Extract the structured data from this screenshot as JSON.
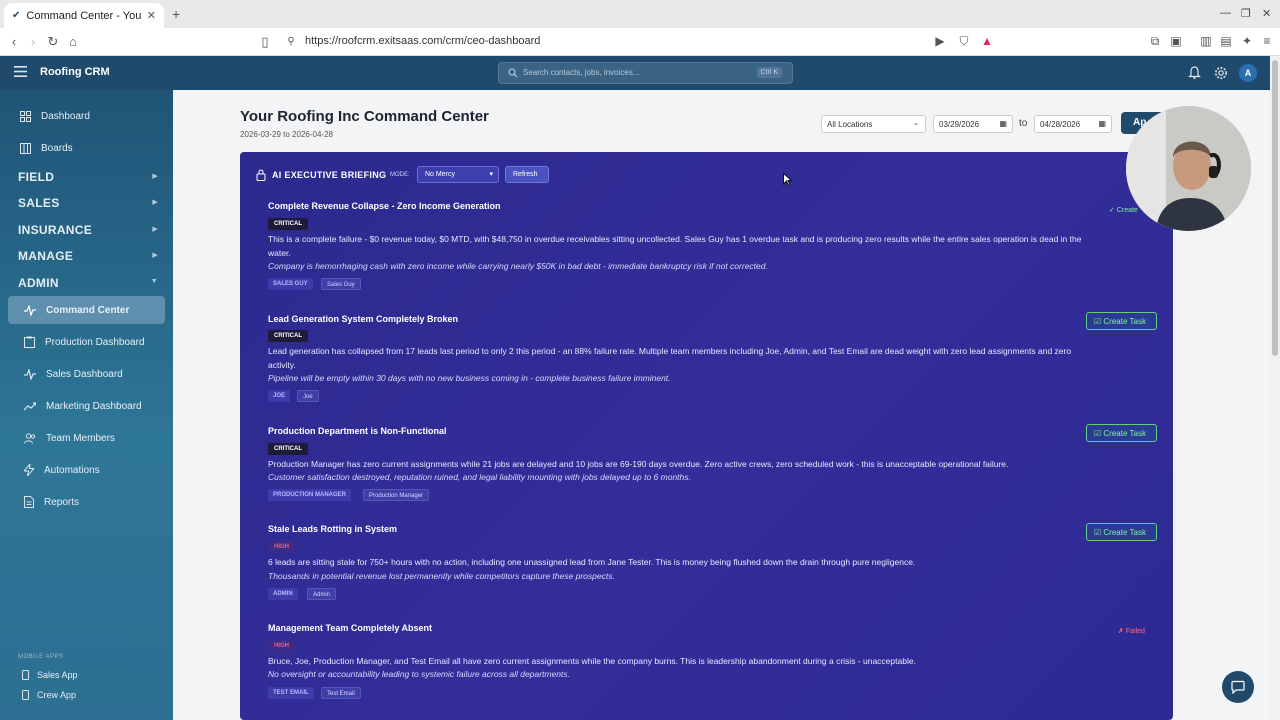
{
  "browser": {
    "tab_title": "Command Center - Your R",
    "url": "https://roofcrm.exitsaas.com/crm/ceo-dashboard"
  },
  "header": {
    "brand": "Roofing CRM",
    "search_placeholder": "Search contacts, jobs, invoices...",
    "search_shortcut": "Ctrl K",
    "avatar_initial": "A"
  },
  "sidebar": {
    "top_items": [
      {
        "label": "Dashboard",
        "icon": "grid-icon"
      },
      {
        "label": "Boards",
        "icon": "board-icon"
      }
    ],
    "sections": [
      "FIELD",
      "SALES",
      "INSURANCE",
      "MANAGE",
      "ADMIN"
    ],
    "admin_items": [
      {
        "label": "Command Center",
        "icon": "pulse-icon",
        "active": true
      },
      {
        "label": "Production Dashboard",
        "icon": "clipboard-icon"
      },
      {
        "label": "Sales Dashboard",
        "icon": "pulse-icon"
      },
      {
        "label": "Marketing Dashboard",
        "icon": "trend-icon"
      },
      {
        "label": "Team Members",
        "icon": "users-icon"
      },
      {
        "label": "Automations",
        "icon": "bolt-icon"
      },
      {
        "label": "Reports",
        "icon": "document-icon"
      }
    ],
    "mobile_heading": "MOBILE APPS",
    "mobile_items": [
      "Sales App",
      "Crew App"
    ]
  },
  "page": {
    "title": "Your Roofing Inc Command Center",
    "range": "2026-03-29 to 2026-04-28",
    "location_filter": "All Locations",
    "date_from": "03/29/2026",
    "to_label": "to",
    "date_to": "04/28/2026",
    "apply_label": "Ap"
  },
  "briefing": {
    "title": "AI EXECUTIVE BRIEFING",
    "mode_label": "MODE:",
    "mode_value": "No Mercy",
    "refresh_label": "Refresh",
    "create_task_label": "Create Task",
    "created_label": "Create",
    "failed_label": "Failed",
    "items": [
      {
        "title": "Complete Revenue Collapse - Zero Income Generation",
        "severity": "CRITICAL",
        "body": "This is a complete failure - $0 revenue today, $0 MTD, with $48,750 in overdue receivables sitting uncollected. Sales Guy has 1 overdue task and is producing zero results while the entire sales operation is dead in the water.",
        "impact": "Company is hemorrhaging cash with zero income while carrying nearly $50K in bad debt - immediate bankruptcy risk if not corrected.",
        "role_tag": "SALES GUY",
        "person_tag": "Sales Guy"
      },
      {
        "title": "Lead Generation System Completely Broken",
        "severity": "CRITICAL",
        "body": "Lead generation has collapsed from 17 leads last period to only 2 this period - an 88% failure rate. Multiple team members including Joe, Admin, and Test Email are dead weight with zero lead assignments and zero activity.",
        "impact": "Pipeline will be empty within 30 days with no new business coming in - complete business failure imminent.",
        "role_tag": "JOE",
        "person_tag": "Joe"
      },
      {
        "title": "Production Department is Non-Functional",
        "severity": "CRITICAL",
        "body": "Production Manager has zero current assignments while 21 jobs are delayed and 10 jobs are 69-190 days overdue. Zero active crews, zero scheduled work - this is unacceptable operational failure.",
        "impact": "Customer satisfaction destroyed, reputation ruined, and legal liability mounting with jobs delayed up to 6 months.",
        "role_tag": "PRODUCTION MANAGER",
        "person_tag": "Production Manager"
      },
      {
        "title": "Stale Leads Rotting in System",
        "severity": "HIGH",
        "body": "6 leads are sitting stale for 750+ hours with no action, including one unassigned lead from Jane Tester. This is money being flushed down the drain through pure negligence.",
        "impact": "Thousands in potential revenue lost permanently while competitors capture these prospects.",
        "role_tag": "ADMIN",
        "person_tag": "Admin"
      },
      {
        "title": "Management Team Completely Absent",
        "severity": "HIGH",
        "body": "Bruce, Joe, Production Manager, and Test Email all have zero current assignments while the company burns. This is leadership abandonment during a crisis - unacceptable.",
        "impact": "No oversight or accountability leading to systemic failure across all departments.",
        "role_tag": "TEST EMAIL",
        "person_tag": "Test Email"
      }
    ]
  }
}
